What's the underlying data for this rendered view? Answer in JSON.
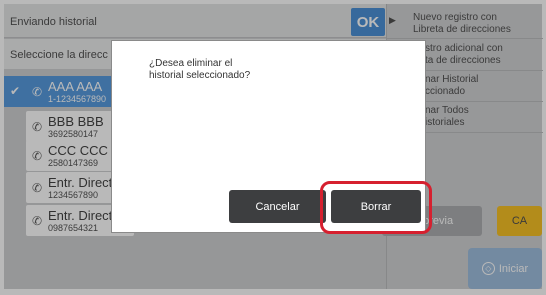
{
  "header": {
    "title": "Enviando historial",
    "ok_label": "OK"
  },
  "select_bar": {
    "label": "Seleccione la direcc"
  },
  "history": [
    {
      "name": "AAA AAA",
      "number": "1-1234567890",
      "selected": true
    },
    {
      "name": "BBB BBB",
      "number": "3692580147",
      "selected": false
    },
    {
      "name": "CCC CCC",
      "number": "2580147369",
      "selected": false
    },
    {
      "name": "Entr. Direct",
      "number": "1234567890",
      "selected": false
    },
    {
      "name": "Entr. Direct",
      "number": "0987654321",
      "selected": false
    }
  ],
  "right_panel": {
    "items": [
      {
        "line1": "Nuevo registro con",
        "line2": "Libreta de direcciones"
      },
      {
        "line1": "stro adicional con",
        "line2": "ta de direcciones"
      },
      {
        "line1": "nar Historial",
        "line2": "ccionado"
      },
      {
        "line1": "nar Todos",
        "line2": "istoriales"
      }
    ],
    "preview_label": "ta previa",
    "ca_label": "CA",
    "start_label": "Iniciar"
  },
  "dialog": {
    "message_line1": "¿Desea eliminar el",
    "message_line2": "historial seleccionado?",
    "cancel_label": "Cancelar",
    "delete_label": "Borrar"
  },
  "colors": {
    "accent": "#2e7fd1",
    "selected": "#3a8ad9",
    "highlight": "#d6202f",
    "ca": "#f6b600"
  }
}
